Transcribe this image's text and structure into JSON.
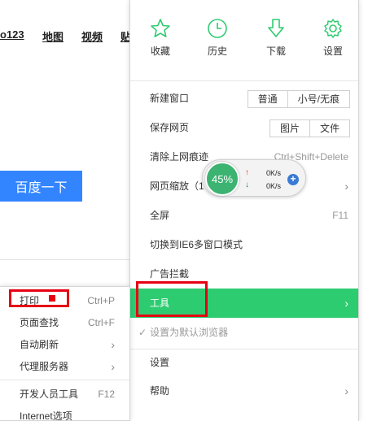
{
  "background": {
    "nav_links": [
      "o123",
      "地图",
      "视频",
      "贴"
    ],
    "search_button": "百度一下"
  },
  "menu": {
    "top_icons": [
      {
        "label": "收藏",
        "icon": "star-icon"
      },
      {
        "label": "历史",
        "icon": "clock-icon"
      },
      {
        "label": "下载",
        "icon": "download-icon"
      },
      {
        "label": "设置",
        "icon": "gear-icon"
      }
    ],
    "new_window": {
      "label": "新建窗口",
      "options": [
        "普通",
        "小号/无痕"
      ]
    },
    "save_page": {
      "label": "保存网页",
      "options": [
        "图片",
        "文件"
      ]
    },
    "clear_history": {
      "label": "清除上网痕迹",
      "shortcut": "Ctrl+Shift+Delete"
    },
    "zoom": {
      "label": "网页缩放（1"
    },
    "fullscreen": {
      "label": "全屏",
      "shortcut": "F11"
    },
    "ie6": {
      "label": "切换到IE6多窗口模式"
    },
    "adblock": {
      "label": "广告拦截"
    },
    "tools": {
      "label": "工具"
    },
    "default_browser": {
      "label": "设置为默认浏览器",
      "check": "✓"
    },
    "settings": {
      "label": "设置"
    },
    "help": {
      "label": "帮助"
    },
    "accent_color": "#2ecc71",
    "highlight_color": "#e60012"
  },
  "speed_widget": {
    "percent": "45%",
    "up_arrow": "↑",
    "down_arrow": "↓",
    "upload": "0K/s",
    "download": "0K/s",
    "plus": "+"
  },
  "submenu": {
    "items": [
      {
        "label": "打印",
        "shortcut": "Ctrl+P"
      },
      {
        "label": "页面查找",
        "shortcut": "Ctrl+F"
      },
      {
        "label": "自动刷新",
        "arrow": "›"
      },
      {
        "label": "代理服务器",
        "arrow": "›"
      },
      {
        "label": "开发人员工具",
        "shortcut": "F12"
      },
      {
        "label": "Internet选项"
      }
    ]
  },
  "arrow_glyph": "›"
}
